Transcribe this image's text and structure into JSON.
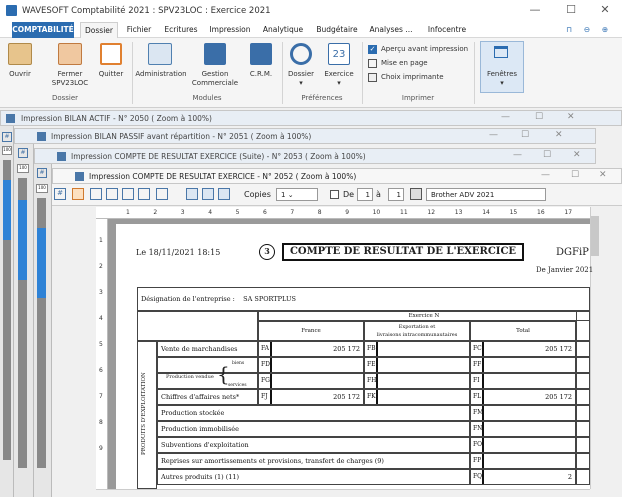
{
  "app": {
    "title": "WAVESOFT Comptabilité 2021 : SPV23LOC : Exercice 2021",
    "min": "—",
    "max": "☐",
    "close": "✕"
  },
  "menu": {
    "app": "COMPTABILITÉ",
    "items": [
      "Dossier",
      "Fichier",
      "Ecritures",
      "Impression",
      "Analytique",
      "Budgétaire",
      "Analyses ...",
      "Infocentre"
    ],
    "pin": "⊓",
    "back": "⊖",
    "fwd": "⊕"
  },
  "ribbon": {
    "ouvrir": "Ouvrir",
    "fermer": "Fermer",
    "fermer2": "SPV23LOC",
    "quitter": "Quitter",
    "g_dossier": "Dossier",
    "admin": "Administration",
    "gestion": "Gestion",
    "gestion2": "Commerciale",
    "crm": "C.R.M.",
    "g_modules": "Modules",
    "dossier": "Dossier",
    "exercice": "Exercice",
    "exercice_num": "23",
    "g_pref": "Préférences",
    "apercu": "Aperçu avant impression",
    "mise": "Mise en page",
    "choix": "Choix imprimante",
    "g_imprimer": "Imprimer",
    "fenetres": "Fenêtres"
  },
  "docs": [
    "Impression BILAN ACTIF - N° 2050 ( Zoom à 100%)",
    "Impression BILAN PASSIF avant répartition - N° 2051 ( Zoom à 100%)",
    "Impression COMPTE DE RESULTAT EXERCICE (Suite) - N° 2053 ( Zoom à 100%)",
    "Impression COMPTE DE RESULTAT EXERCICE - N° 2052 ( Zoom à 100%)"
  ],
  "toolbar": {
    "copies_label": "Copies",
    "copies": "1",
    "de_label": "De",
    "from": "1",
    "a_label": "à",
    "to": "1",
    "printer": "Brother ADV 2021",
    "zoom": "100"
  },
  "ruler": [
    "1",
    "2",
    "3",
    "4",
    "5",
    "6",
    "7",
    "8",
    "9",
    "10",
    "11",
    "12",
    "13",
    "14",
    "15",
    "16",
    "17"
  ],
  "report": {
    "date": "Le 18/11/2021 18:15",
    "num": "3",
    "title": "COMPTE DE RESULTAT DE L'EXERCICE",
    "dgfip": "DGFiP",
    "period": "De Janvier 2021",
    "desig_label": "Désignation de l'entreprise :",
    "desig": "SA SPORTPLUS",
    "exercice": "Exercice N",
    "france": "France",
    "export": "Exportation et",
    "export2": "livraisons intracommunautaires",
    "total": "Total",
    "section": "PRODUITS D'EXPLOITATION",
    "prod_vendue": "Production vendue",
    "biens": "biens",
    "services": "services",
    "rows": [
      {
        "label": "Vente de marchandises",
        "c1": "FA",
        "v1": "205 172",
        "c2": "FB",
        "v2": "",
        "c3": "FC",
        "v3": "205 172"
      },
      {
        "label": "",
        "c1": "FD",
        "v1": "",
        "c2": "FE",
        "v2": "",
        "c3": "FF",
        "v3": ""
      },
      {
        "label": "",
        "c1": "FG",
        "v1": "",
        "c2": "FH",
        "v2": "",
        "c3": "FI",
        "v3": ""
      },
      {
        "label": "Chiffres d'affaires nets*",
        "c1": "FJ",
        "v1": "205 172",
        "c2": "FK",
        "v2": "",
        "c3": "FL",
        "v3": "205 172"
      },
      {
        "label": "Production stockée",
        "c3": "FM",
        "v3": ""
      },
      {
        "label": "Production immobilisée",
        "c3": "FN",
        "v3": ""
      },
      {
        "label": "Subventions d'exploitation",
        "c3": "FO",
        "v3": ""
      },
      {
        "label": "Reprises sur amortissements et provisions, transfert de charges (9)",
        "c3": "FP",
        "v3": ""
      },
      {
        "label": "Autres produits (1) (11)",
        "c3": "FQ",
        "v3": "2"
      }
    ]
  }
}
